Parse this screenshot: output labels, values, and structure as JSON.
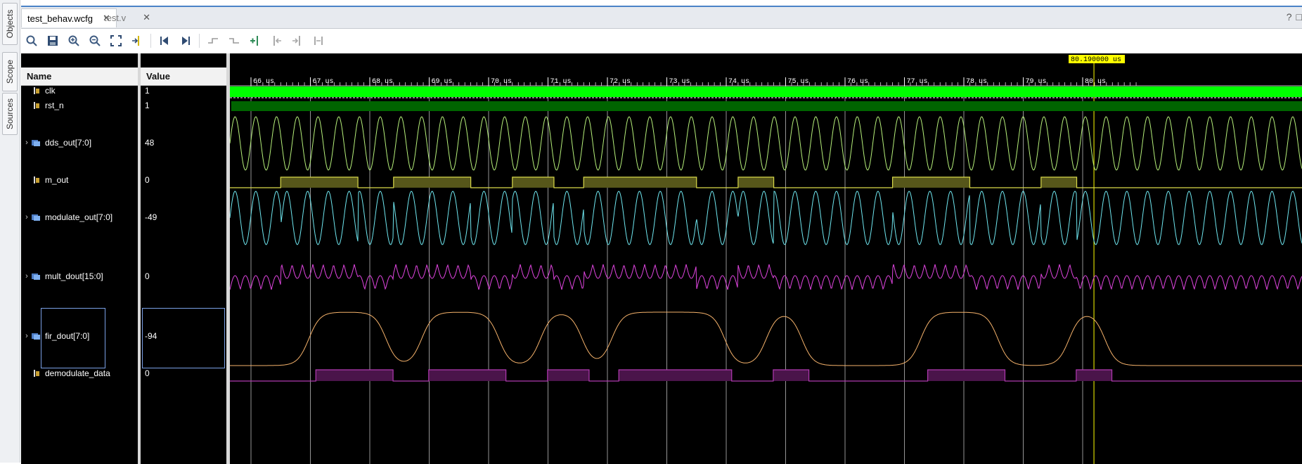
{
  "side_tabs": [
    "Objects",
    "Scope",
    "Sources"
  ],
  "tabs": [
    {
      "label": "test_behav.wcfg",
      "active": true
    },
    {
      "label": "test.v",
      "active": false
    }
  ],
  "window_controls": {
    "help": "?",
    "restore": "□"
  },
  "toolbar": {
    "icons": [
      "search-icon",
      "save-icon",
      "zoom-in-icon",
      "zoom-out-icon",
      "zoom-fit-icon",
      "go-to-cursor-icon",
      "go-to-time-0-icon",
      "go-to-last-time-icon",
      "previous-transition-icon",
      "next-transition-icon",
      "add-marker-icon",
      "previous-marker-icon",
      "next-marker-icon",
      "swap-cursors-icon"
    ]
  },
  "columns": {
    "name": "Name",
    "value": "Value"
  },
  "signals": [
    {
      "name": "clk",
      "value": "1",
      "expandable": false
    },
    {
      "name": "rst_n",
      "value": "1",
      "expandable": false
    },
    {
      "name": "dds_out[7:0]",
      "value": "48",
      "expandable": true
    },
    {
      "name": "m_out",
      "value": "0",
      "expandable": false
    },
    {
      "name": "modulate_out[7:0]",
      "value": "-49",
      "expandable": true
    },
    {
      "name": "mult_dout[15:0]",
      "value": "0",
      "expandable": true
    },
    {
      "name": "fir_dout[7:0]",
      "value": "-94",
      "expandable": true
    },
    {
      "name": "demodulate_data",
      "value": "0",
      "expandable": false
    }
  ],
  "timeline": {
    "ticks": [
      "66 us",
      "67 us",
      "68 us",
      "69 us",
      "70 us",
      "71 us",
      "72 us",
      "73 us",
      "74 us",
      "75 us",
      "76 us",
      "77 us",
      "78 us",
      "79 us",
      "80 us"
    ],
    "cursor_time": "80.190000 us",
    "m_out_high_intervals_us": [
      [
        66.5,
        67.8
      ],
      [
        68.4,
        69.7
      ],
      [
        70.4,
        71.1
      ],
      [
        71.6,
        73.5
      ],
      [
        74.2,
        74.8
      ],
      [
        76.8,
        78.1
      ],
      [
        79.3,
        79.9
      ]
    ]
  },
  "colors": {
    "clk": "#00ff00",
    "rst_n": "#006400",
    "dds_out": "#b6f07a",
    "m_out": "#d9d94a",
    "modulate_out": "#6fe7f0",
    "mult_dout": "#e045e0",
    "fir_dout": "#f5b26b",
    "demodulate_data": "#b13ab1",
    "cursor": "#ffff00"
  }
}
